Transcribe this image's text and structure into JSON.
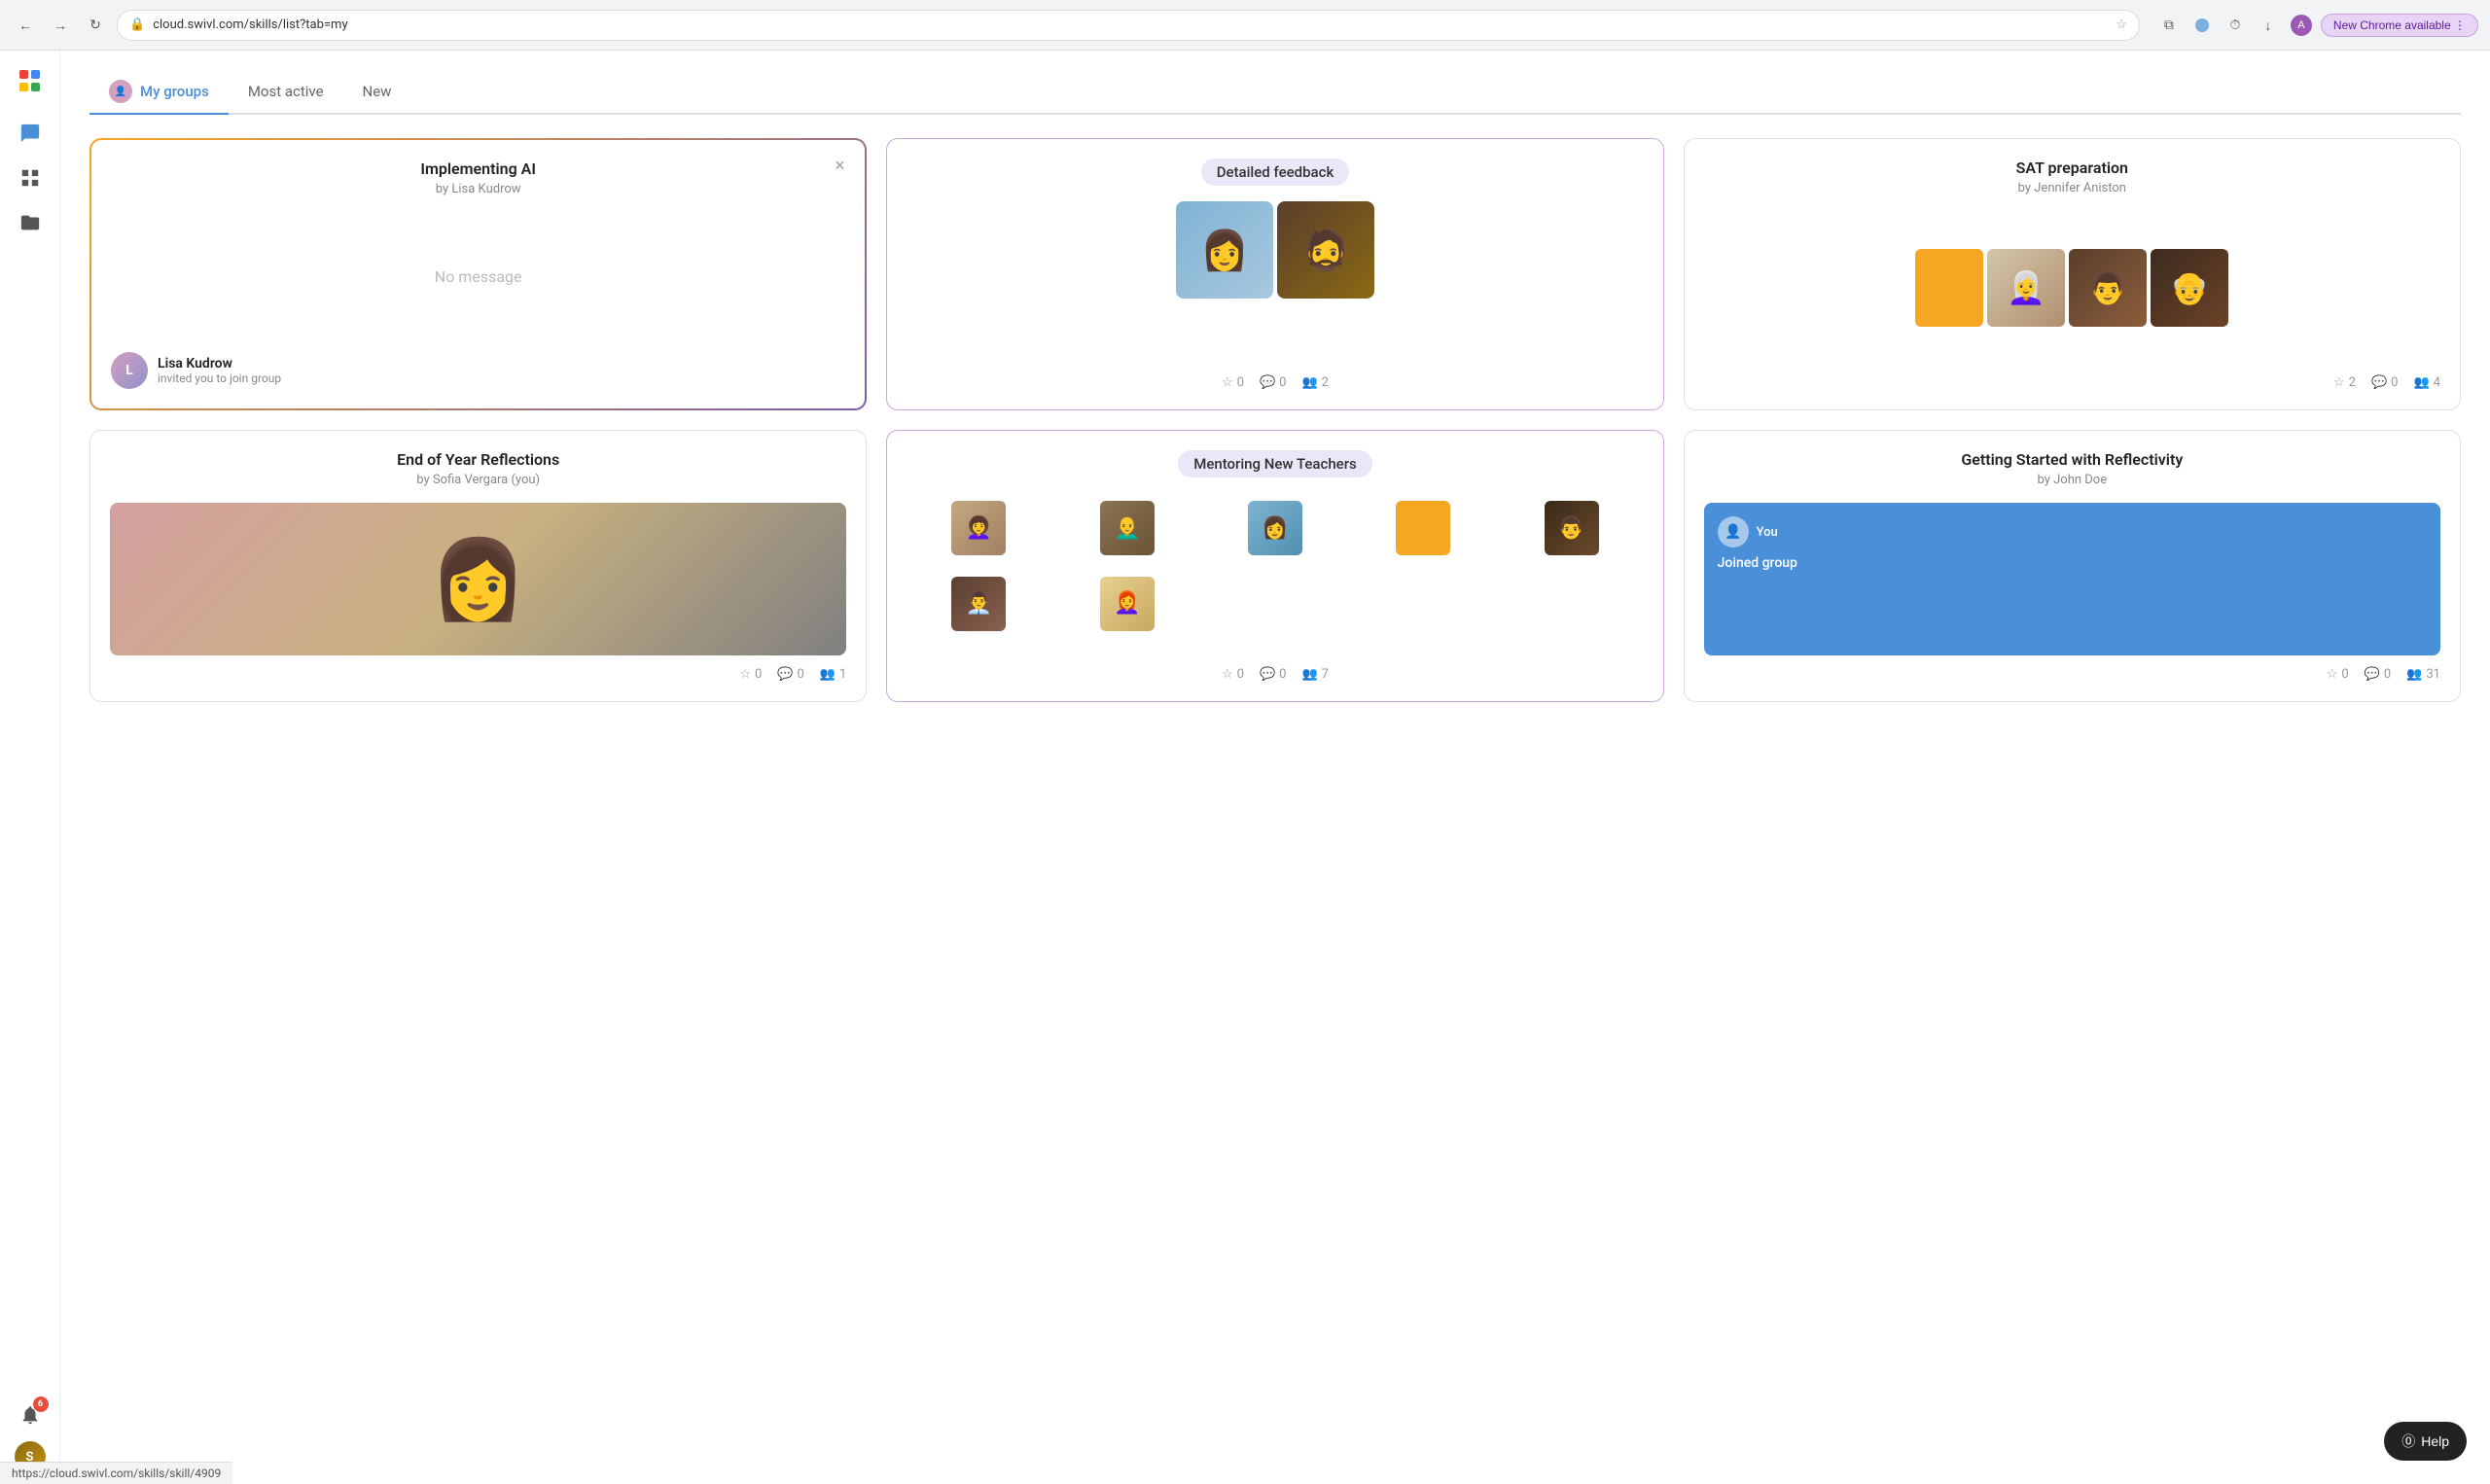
{
  "browser": {
    "url": "cloud.swivl.com/skills/list?tab=my",
    "new_chrome_label": "New Chrome available"
  },
  "tabs": [
    {
      "id": "my-groups",
      "label": "My groups",
      "active": true
    },
    {
      "id": "most-active",
      "label": "Most active",
      "active": false
    },
    {
      "id": "new",
      "label": "New",
      "active": false
    }
  ],
  "cards": [
    {
      "id": "implementing-ai",
      "title": "Implementing AI",
      "subtitle": "by Lisa Kudrow",
      "no_message": "No message",
      "inviter_name": "Lisa Kudrow",
      "inviter_desc": "invited you to join group",
      "style": "dashed"
    },
    {
      "id": "detailed-feedback",
      "title": "Detailed feedback",
      "style": "badge",
      "stats": {
        "stars": 0,
        "comments": 0,
        "members": 2
      }
    },
    {
      "id": "sat-preparation",
      "title": "SAT preparation",
      "subtitle": "by Jennifer Aniston",
      "style": "normal",
      "stats": {
        "stars": 2,
        "comments": 0,
        "members": 4
      }
    },
    {
      "id": "end-of-year",
      "title": "End of Year Reflections",
      "subtitle": "by Sofia Vergara (you)",
      "style": "normal",
      "stats": {
        "stars": 0,
        "comments": 0,
        "members": 1
      }
    },
    {
      "id": "mentoring-new-teachers",
      "title": "Mentoring New Teachers",
      "style": "badge",
      "stats": {
        "stars": 0,
        "comments": 0,
        "members": 7
      }
    },
    {
      "id": "getting-started",
      "title": "Getting Started with Reflectivity",
      "subtitle": "by John Doe",
      "style": "blue-message",
      "you_label": "You",
      "joined_label": "Joined group",
      "stats": {
        "stars": 0,
        "comments": 0,
        "members": 31
      }
    }
  ],
  "help_label": "⓪ Help",
  "status_url": "https://cloud.swivl.com/skills/skill/4909",
  "notification_count": "6",
  "icons": {
    "back": "←",
    "forward": "→",
    "reload": "↻",
    "star": "☆",
    "comment": "💬",
    "members": "👥",
    "close": "×",
    "shield": "🔒",
    "chat": "💬",
    "grid": "⊞",
    "folder": "📁",
    "bell": "🔔",
    "lock": "🔒",
    "search": "🔍",
    "download": "⬇",
    "more": "⋮",
    "question": "?",
    "star_filled": "★"
  }
}
